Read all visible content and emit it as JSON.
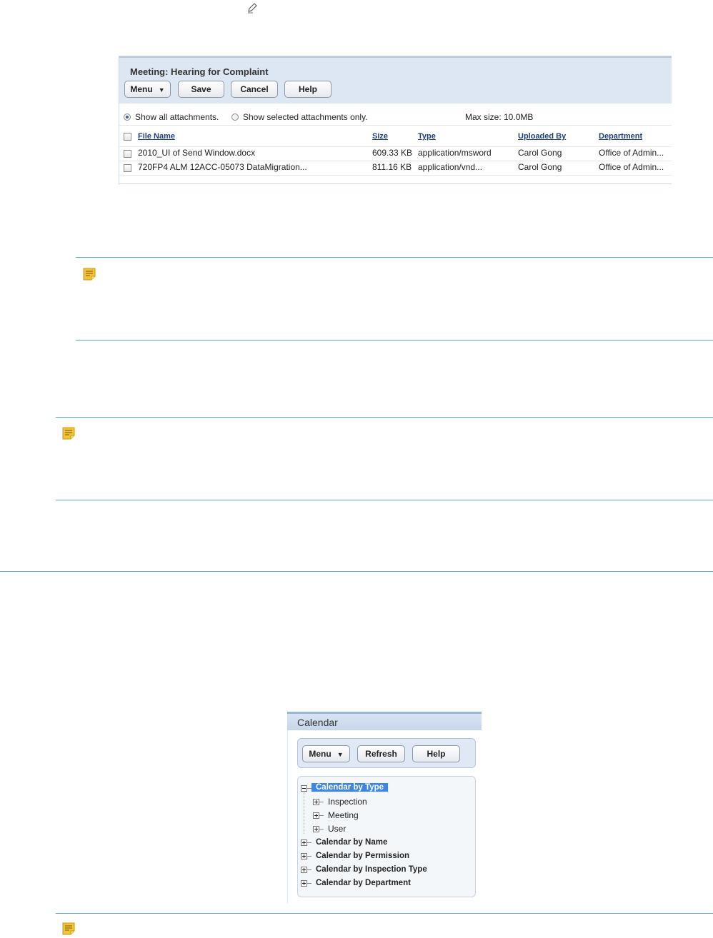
{
  "icons": {
    "edit": "pencil-icon",
    "note": "note-icon"
  },
  "colors": {
    "header_bg": "#dde7f4",
    "link": "#1e3f7a",
    "separator": "#5ea6b8",
    "selected_node": "#3d86e6",
    "note_icon": "#f2c23b"
  },
  "attachments": {
    "title": "Meeting: Hearing for Complaint",
    "buttons": {
      "menu": "Menu",
      "save": "Save",
      "cancel": "Cancel",
      "help": "Help"
    },
    "filter": {
      "show_all": "Show all attachments.",
      "show_selected": "Show selected attachments only.",
      "selected": "show_all"
    },
    "max_size": "Max size: 10.0MB",
    "columns": [
      "File Name",
      "Size",
      "Type",
      "Uploaded By",
      "Department"
    ],
    "rows": [
      [
        "2010_UI of Send Window.docx",
        "609.33 KB",
        "application/msword",
        "Carol Gong",
        "Office of Admin..."
      ],
      [
        "720FP4 ALM 12ACC-05073 DataMigration...",
        "811.16 KB",
        "application/vnd...",
        "Carol Gong",
        "Office of Admin..."
      ]
    ]
  },
  "calendar": {
    "title": "Calendar",
    "buttons": {
      "menu": "Menu",
      "refresh": "Refresh",
      "help": "Help"
    },
    "tree": {
      "root_selected": "Calendar by Type",
      "children": [
        "Inspection",
        "Meeting",
        "User"
      ],
      "others": [
        "Calendar by Name",
        "Calendar by Permission",
        "Calendar by Inspection Type",
        "Calendar by Department"
      ]
    }
  }
}
